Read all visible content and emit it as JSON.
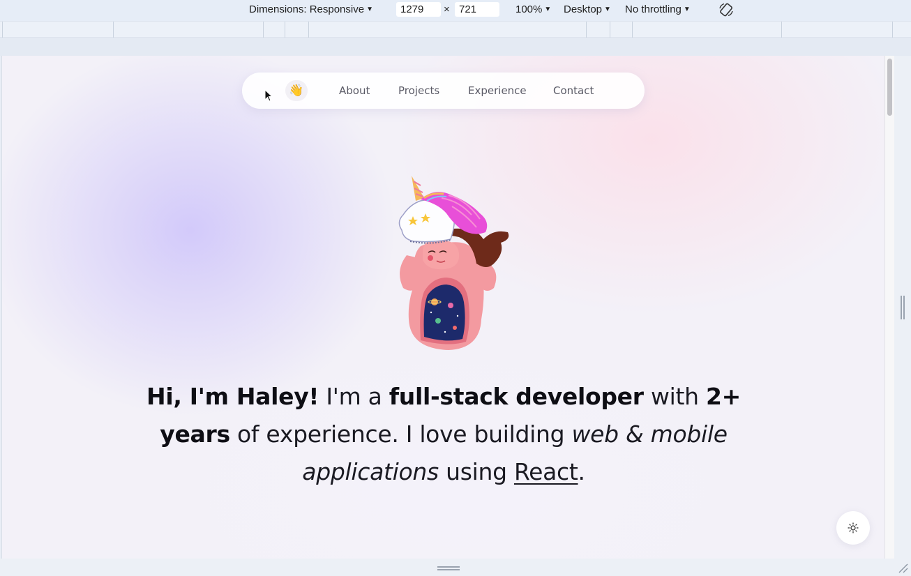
{
  "devtools": {
    "dimensions_label": "Dimensions: Responsive",
    "width_value": "1279",
    "times_symbol": "×",
    "height_value": "721",
    "zoom_label": "100%",
    "device_label": "Desktop",
    "throttling_label": "No throttling",
    "caret": "▼",
    "icons": [
      "rotate-icon",
      "caret-down-icon"
    ]
  },
  "site": {
    "nav": {
      "wave_emoji": "👋",
      "links": [
        "About",
        "Projects",
        "Experience",
        "Contact"
      ]
    },
    "hero": {
      "greeting": "Hi, I'm Haley!",
      "t1": " I'm a ",
      "role": "full-stack developer",
      "t2": " with ",
      "years": "2+ years",
      "t3": " of experience. I love building ",
      "apps": "web & mobile applications",
      "t4": " using ",
      "tech": "React",
      "t5": "."
    },
    "theme_toggle_icon": "sun-icon"
  },
  "colors": {
    "toolbar_bg": "#e6edf7",
    "nav_text": "#5a5a66",
    "hero_text": "#1a1a22",
    "illustration_skin": "#f39aa0",
    "illustration_hair": "#6e2a1a",
    "illustration_mane": "#e84fd8"
  }
}
